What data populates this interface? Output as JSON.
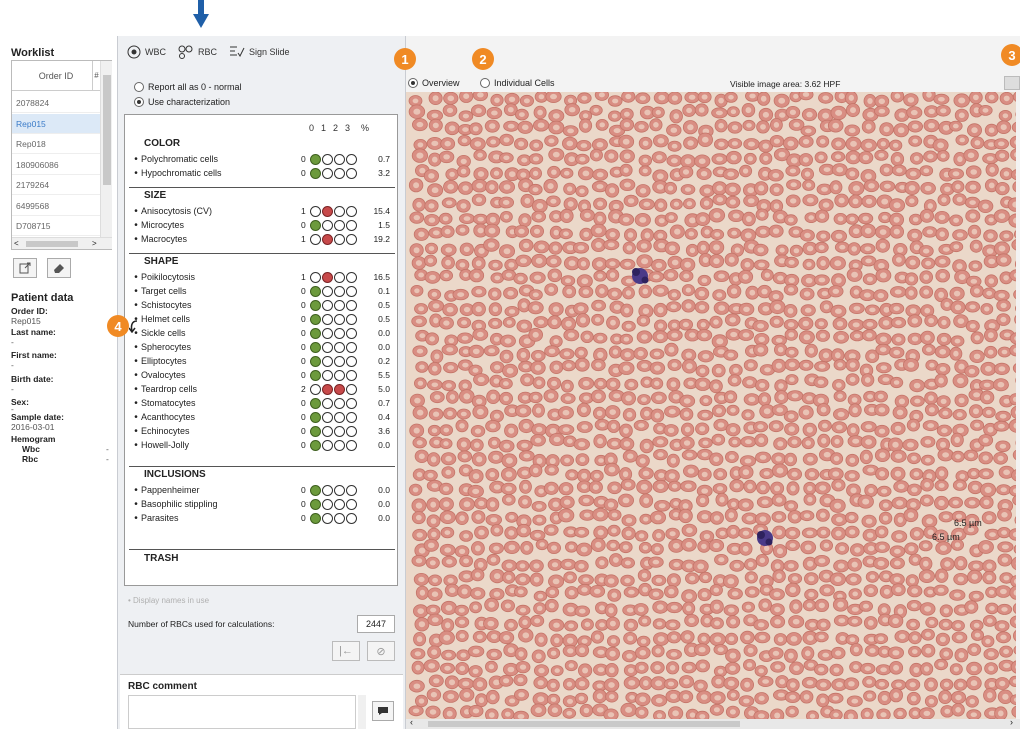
{
  "worklist": {
    "title": "Worklist",
    "column_header": "Order ID",
    "column_header_2": "#",
    "rows": [
      "2078824",
      "Rep015",
      "Rep018",
      "180906086",
      "2179264",
      "6499568",
      "D708715"
    ],
    "selected_index": 1,
    "scroll_left": "<",
    "scroll_right": ">"
  },
  "patient": {
    "title": "Patient data",
    "order_id_label": "Order ID:",
    "order_id": "Rep015",
    "last_name_label": "Last name:",
    "last_name": "-",
    "first_name_label": "First name:",
    "first_name": "-",
    "birth_date_label": "Birth date:",
    "birth_date": "-",
    "sex_label": "Sex:",
    "sex": "-",
    "sample_date_label": "Sample date:",
    "sample_date": "2016-03-01",
    "hemogram_label": "Hemogram",
    "wbc_label": "Wbc",
    "wbc_value": "-",
    "rbc_label": "Rbc",
    "rbc_value": "-"
  },
  "tabs": {
    "wbc": "WBC",
    "rbc": "RBC",
    "sign": "Sign Slide"
  },
  "options": {
    "report_all": "Report all as 0 - normal",
    "use_char": "Use characterization"
  },
  "grade_header": {
    "g0": "0",
    "g1": "1",
    "g2": "2",
    "g3": "3",
    "pct": "%"
  },
  "sections": {
    "color": "COLOR",
    "size": "SIZE",
    "shape": "SHAPE",
    "inclusions": "INCLUSIONS",
    "trash": "TRASH"
  },
  "rows": [
    {
      "label": "Polychromatic cells",
      "level": "0",
      "grades": [
        "g",
        "",
        "",
        ""
      ],
      "pct": "0.7"
    },
    {
      "label": "Hypochromatic cells",
      "level": "0",
      "grades": [
        "g",
        "",
        "",
        ""
      ],
      "pct": "3.2"
    },
    {
      "label": "Anisocytosis (CV)",
      "level": "1",
      "grades": [
        "",
        "r",
        "",
        ""
      ],
      "pct": "15.4"
    },
    {
      "label": "Microcytes",
      "level": "0",
      "grades": [
        "g",
        "",
        "",
        ""
      ],
      "pct": "1.5"
    },
    {
      "label": "Macrocytes",
      "level": "1",
      "grades": [
        "",
        "r",
        "",
        ""
      ],
      "pct": "19.2"
    },
    {
      "label": "Poikilocytosis",
      "level": "1",
      "grades": [
        "",
        "r",
        "",
        ""
      ],
      "pct": "16.5"
    },
    {
      "label": "Target cells",
      "level": "0",
      "grades": [
        "g",
        "",
        "",
        ""
      ],
      "pct": "0.1"
    },
    {
      "label": "Schistocytes",
      "level": "0",
      "grades": [
        "g",
        "",
        "",
        ""
      ],
      "pct": "0.5"
    },
    {
      "label": "Helmet cells",
      "level": "0",
      "grades": [
        "g",
        "",
        "",
        ""
      ],
      "pct": "0.5"
    },
    {
      "label": "Sickle cells",
      "level": "0",
      "grades": [
        "g",
        "",
        "",
        ""
      ],
      "pct": "0.0"
    },
    {
      "label": "Spherocytes",
      "level": "0",
      "grades": [
        "g",
        "",
        "",
        ""
      ],
      "pct": "0.0"
    },
    {
      "label": "Elliptocytes",
      "level": "0",
      "grades": [
        "g",
        "",
        "",
        ""
      ],
      "pct": "0.2"
    },
    {
      "label": "Ovalocytes",
      "level": "0",
      "grades": [
        "g",
        "",
        "",
        ""
      ],
      "pct": "5.5"
    },
    {
      "label": "Teardrop cells",
      "level": "2",
      "grades": [
        "",
        "r",
        "r",
        ""
      ],
      "pct": "5.0"
    },
    {
      "label": "Stomatocytes",
      "level": "0",
      "grades": [
        "g",
        "",
        "",
        ""
      ],
      "pct": "0.7"
    },
    {
      "label": "Acanthocytes",
      "level": "0",
      "grades": [
        "g",
        "",
        "",
        ""
      ],
      "pct": "0.4"
    },
    {
      "label": "Echinocytes",
      "level": "0",
      "grades": [
        "g",
        "",
        "",
        ""
      ],
      "pct": "3.6"
    },
    {
      "label": "Howell-Jolly",
      "level": "0",
      "grades": [
        "g",
        "",
        "",
        ""
      ],
      "pct": "0.0"
    },
    {
      "label": "Pappenheimer",
      "level": "0",
      "grades": [
        "g",
        "",
        "",
        ""
      ],
      "pct": "0.0"
    },
    {
      "label": "Basophilic stippling",
      "level": "0",
      "grades": [
        "g",
        "",
        "",
        ""
      ],
      "pct": "0.0"
    },
    {
      "label": "Parasites",
      "level": "0",
      "grades": [
        "g",
        "",
        "",
        ""
      ],
      "pct": "0.0"
    }
  ],
  "lower": {
    "display_names": "Display names in use",
    "num_rbc_label": "Number of RBCs used for calculations:",
    "num_rbc": "2447",
    "comment_title": "RBC comment"
  },
  "viewer": {
    "overview": "Overview",
    "individual": "Individual Cells",
    "visible_area": "Visible image area: 3.62 HPF",
    "measure_1": "6.5 µm",
    "measure_2": "6.5 µm"
  },
  "badges": [
    "1",
    "2",
    "3",
    "4"
  ],
  "colors": {
    "accent_orange": "#f08a24",
    "marker_blue": "#1f5fa8",
    "grade_green": "#6c9a3c",
    "grade_red": "#c7494a"
  }
}
